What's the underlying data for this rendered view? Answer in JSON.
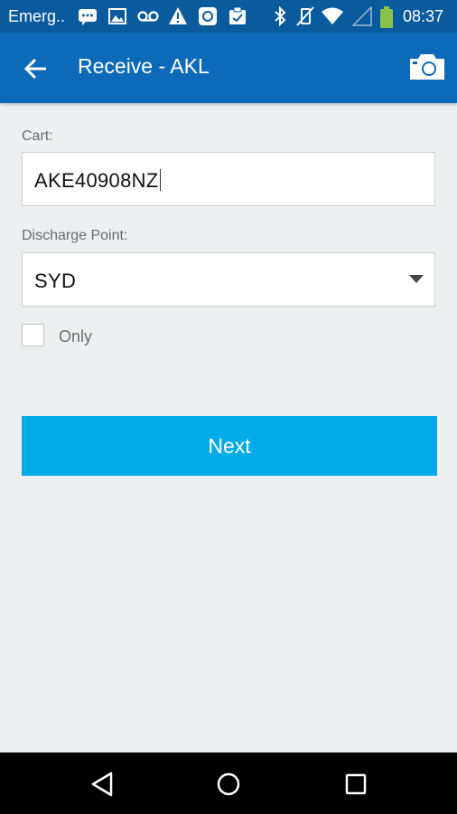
{
  "status_bar": {
    "carrier": "Emerg..",
    "time": "08:37",
    "icons": [
      "chat-icon",
      "image-icon",
      "voicemail-icon",
      "warning-icon",
      "sync-icon",
      "clipboard-icon",
      "bluetooth-icon",
      "vibrate-off-icon",
      "wifi-icon",
      "signal-icon",
      "battery-icon"
    ]
  },
  "app_bar": {
    "title": "Receive - AKL",
    "back_icon": "arrow-left-icon",
    "camera_icon": "camera-icon"
  },
  "form": {
    "cart_label": "Cart:",
    "cart_value": "AKE40908NZ",
    "discharge_label": "Discharge Point:",
    "discharge_value": "SYD",
    "only_label": "Only",
    "only_checked": false,
    "next_label": "Next"
  },
  "colors": {
    "status_bar": "#0a5b9e",
    "app_bar": "#0d6ab8",
    "background": "#eeeff1",
    "accent_button": "#03abe9",
    "battery": "#8bc34a"
  }
}
